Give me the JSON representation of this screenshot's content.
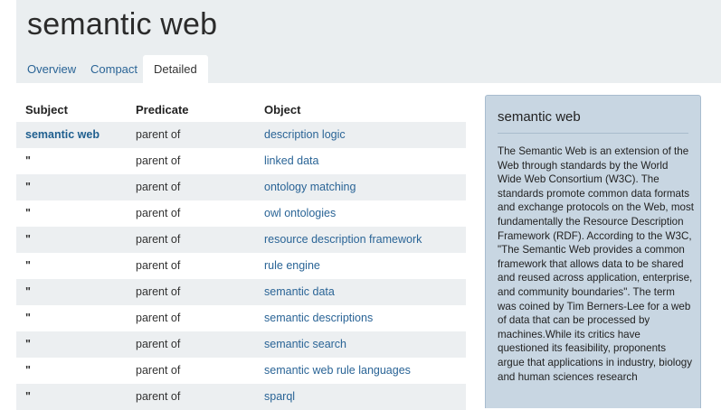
{
  "page": {
    "title": "semantic web"
  },
  "tabs": [
    {
      "label": "Overview",
      "active": false
    },
    {
      "label": "Compact",
      "active": false
    },
    {
      "label": "Detailed",
      "active": true
    }
  ],
  "table": {
    "headers": {
      "subject": "Subject",
      "predicate": "Predicate",
      "object": "Object"
    },
    "rows": [
      {
        "subject": "semantic web",
        "predicate": "parent of",
        "object": "description logic"
      },
      {
        "subject": "\"",
        "predicate": "parent of",
        "object": "linked data"
      },
      {
        "subject": "\"",
        "predicate": "parent of",
        "object": "ontology matching"
      },
      {
        "subject": "\"",
        "predicate": "parent of",
        "object": "owl ontologies"
      },
      {
        "subject": "\"",
        "predicate": "parent of",
        "object": "resource description framework"
      },
      {
        "subject": "\"",
        "predicate": "parent of",
        "object": "rule engine"
      },
      {
        "subject": "\"",
        "predicate": "parent of",
        "object": "semantic data"
      },
      {
        "subject": "\"",
        "predicate": "parent of",
        "object": "semantic descriptions"
      },
      {
        "subject": "\"",
        "predicate": "parent of",
        "object": "semantic search"
      },
      {
        "subject": "\"",
        "predicate": "parent of",
        "object": "semantic web rule languages"
      },
      {
        "subject": "\"",
        "predicate": "parent of",
        "object": "sparql"
      }
    ]
  },
  "sidebar": {
    "title": "semantic web",
    "text": "The Semantic Web is an extension of the Web through standards by the World Wide Web Consortium (W3C). The standards promote common data formats and exchange protocols on the Web, most fundamentally the Resource Description Framework (RDF). According to the W3C, \"The Semantic Web provides a common framework that allows data to be shared and reused across application, enterprise, and community boundaries\". The term was coined by Tim Berners-Lee for a web of data that can be processed by machines.While its critics have questioned its feasibility, proponents argue that applications in industry, biology and human sciences research"
  },
  "colors": {
    "link": "#2a6496",
    "subject_link": "#1f5f8f",
    "sidebar_bg": "#c8d6e2",
    "page_bg": "#eaeef0",
    "row_stripe": "#eceff1"
  }
}
